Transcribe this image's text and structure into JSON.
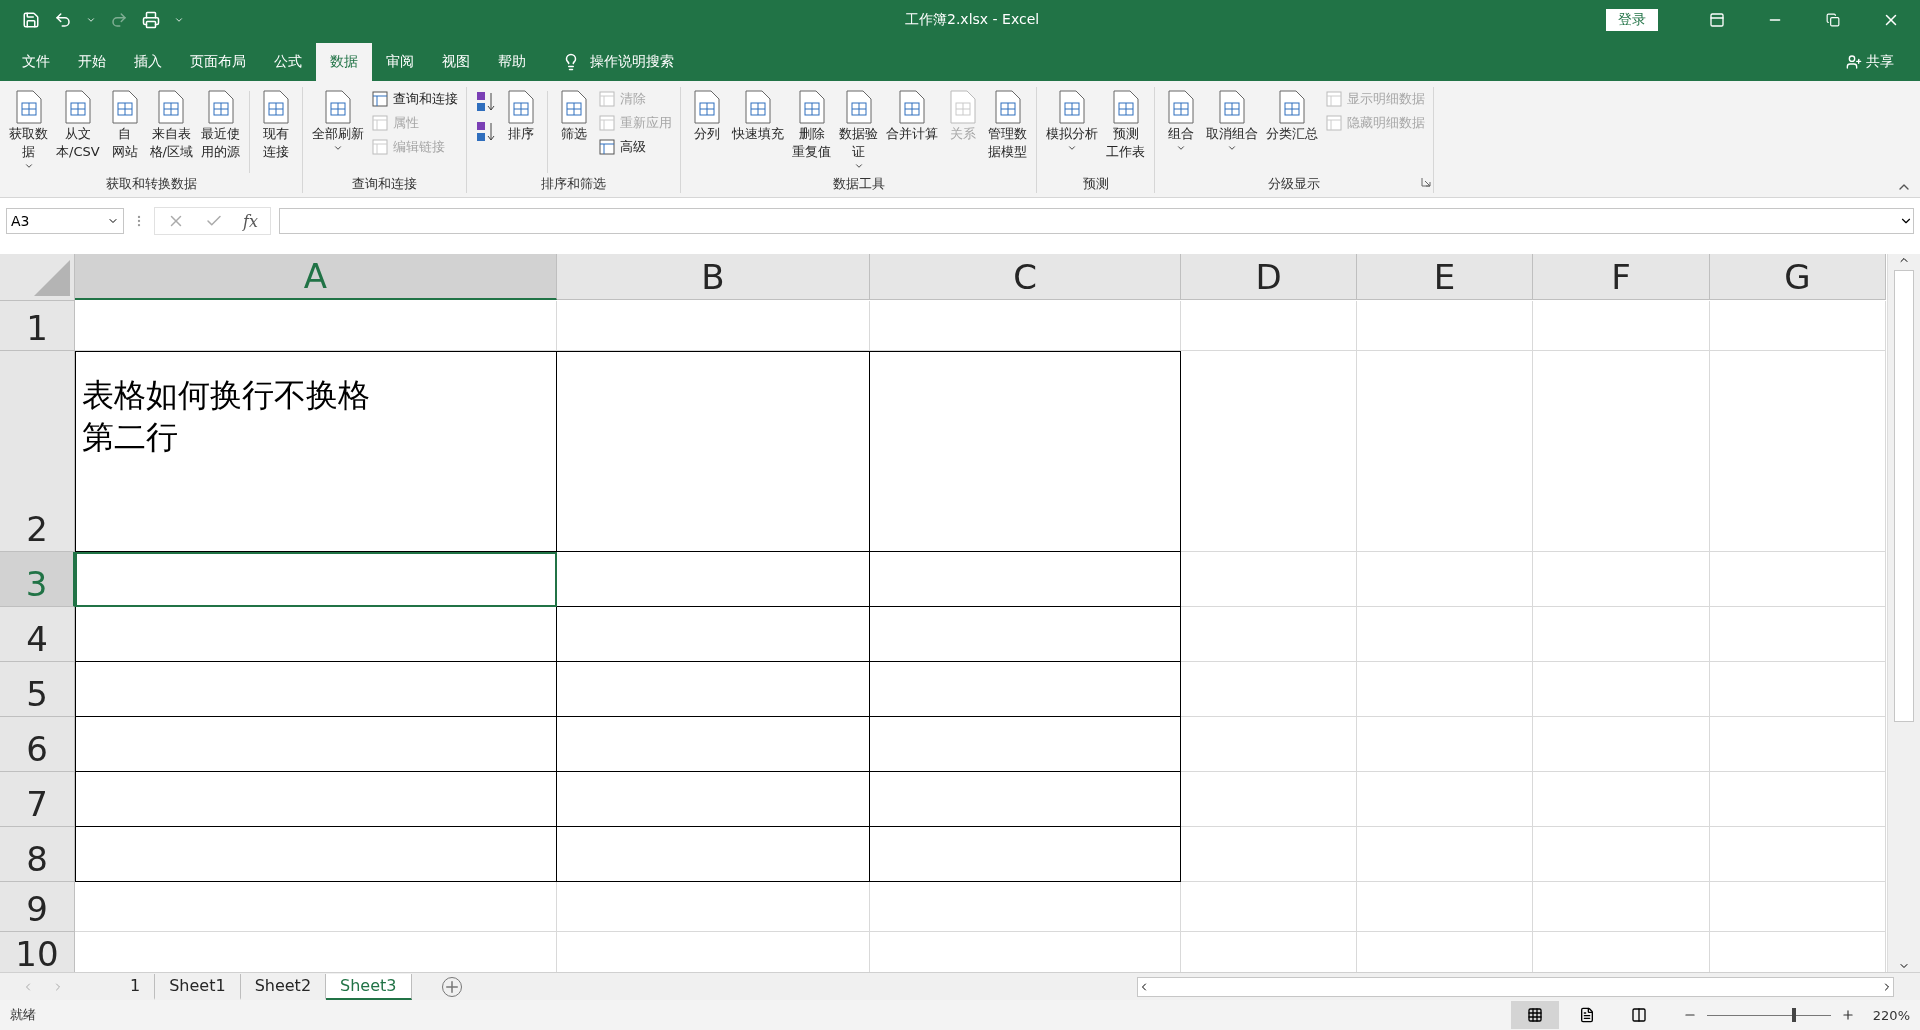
{
  "window": {
    "title": "工作簿2.xlsx  -  Excel",
    "sign_in": "登录"
  },
  "menu_tabs": [
    {
      "label": "文件",
      "selected": false
    },
    {
      "label": "开始",
      "selected": false
    },
    {
      "label": "插入",
      "selected": false
    },
    {
      "label": "页面布局",
      "selected": false
    },
    {
      "label": "公式",
      "selected": false
    },
    {
      "label": "数据",
      "selected": true
    },
    {
      "label": "审阅",
      "selected": false
    },
    {
      "label": "视图",
      "selected": false
    },
    {
      "label": "帮助",
      "selected": false
    }
  ],
  "tell_me": {
    "placeholder": "操作说明搜索"
  },
  "share": "共享",
  "ribbon_groups": [
    {
      "label": "获取和转换数据",
      "items": [
        {
          "kind": "large",
          "lines": [
            "获取数",
            "据"
          ],
          "dropdown": true,
          "disabled": false
        },
        {
          "kind": "large",
          "lines": [
            "从文",
            "本/CSV"
          ],
          "dropdown": false,
          "disabled": false
        },
        {
          "kind": "large",
          "lines": [
            "自",
            "网站"
          ],
          "dropdown": false,
          "disabled": false
        },
        {
          "kind": "large",
          "lines": [
            "来自表",
            "格/区域"
          ],
          "dropdown": false,
          "disabled": false
        },
        {
          "kind": "large",
          "lines": [
            "最近使",
            "用的源"
          ],
          "dropdown": false,
          "disabled": false
        },
        {
          "kind": "separator"
        },
        {
          "kind": "large",
          "lines": [
            "现有",
            "连接"
          ],
          "dropdown": false,
          "disabled": false
        }
      ]
    },
    {
      "label": "查询和连接",
      "items": [
        {
          "kind": "large",
          "lines": [
            "全部刷新"
          ],
          "dropdown": true,
          "disabled": false
        },
        {
          "kind": "stack",
          "items": [
            {
              "kind": "small",
              "label": "查询和连接",
              "disabled": false
            },
            {
              "kind": "small",
              "label": "属性",
              "disabled": true
            },
            {
              "kind": "small",
              "label": "编辑链接",
              "disabled": true
            }
          ]
        }
      ]
    },
    {
      "label": "排序和筛选",
      "items": [
        {
          "kind": "stack",
          "items": [
            {
              "kind": "icon"
            },
            {
              "kind": "icon"
            }
          ]
        },
        {
          "kind": "large",
          "lines": [
            "排序"
          ],
          "dropdown": false,
          "disabled": false
        },
        {
          "kind": "separator"
        },
        {
          "kind": "large",
          "lines": [
            "筛选"
          ],
          "dropdown": false,
          "disabled": false
        },
        {
          "kind": "stack",
          "items": [
            {
              "kind": "small",
              "label": "清除",
              "disabled": true
            },
            {
              "kind": "small",
              "label": "重新应用",
              "disabled": true
            },
            {
              "kind": "small",
              "label": "高级",
              "disabled": false
            }
          ]
        }
      ]
    },
    {
      "label": "数据工具",
      "items": [
        {
          "kind": "large",
          "lines": [
            "分列"
          ],
          "dropdown": false,
          "disabled": false
        },
        {
          "kind": "large",
          "lines": [
            "快速填充"
          ],
          "dropdown": false,
          "disabled": false
        },
        {
          "kind": "large",
          "lines": [
            "删除",
            "重复值"
          ],
          "dropdown": false,
          "disabled": false
        },
        {
          "kind": "large",
          "lines": [
            "数据验",
            "证"
          ],
          "dropdown": true,
          "disabled": false
        },
        {
          "kind": "large",
          "lines": [
            "合并计算"
          ],
          "dropdown": false,
          "disabled": false
        },
        {
          "kind": "large",
          "lines": [
            "关系"
          ],
          "dropdown": false,
          "disabled": true
        },
        {
          "kind": "large",
          "lines": [
            "管理数",
            "据模型"
          ],
          "dropdown": false,
          "disabled": false
        }
      ]
    },
    {
      "label": "预测",
      "items": [
        {
          "kind": "large",
          "lines": [
            "模拟分析"
          ],
          "dropdown": true,
          "disabled": false
        },
        {
          "kind": "large",
          "lines": [
            "预测",
            "工作表"
          ],
          "dropdown": false,
          "disabled": false
        }
      ]
    },
    {
      "label": "分级显示",
      "launcher": true,
      "items": [
        {
          "kind": "large",
          "lines": [
            "组合"
          ],
          "dropdown": true,
          "disabled": false
        },
        {
          "kind": "large",
          "lines": [
            "取消组合"
          ],
          "dropdown": true,
          "disabled": false
        },
        {
          "kind": "large",
          "lines": [
            "分类汇总"
          ],
          "dropdown": false,
          "disabled": false
        },
        {
          "kind": "stack",
          "items": [
            {
              "kind": "small",
              "label": "显示明细数据",
              "disabled": true
            },
            {
              "kind": "small",
              "label": "隐藏明细数据",
              "disabled": true
            }
          ]
        }
      ]
    }
  ],
  "formula_bar": {
    "name_box": "A3",
    "fx": "fx"
  },
  "columns": [
    {
      "label": "A",
      "selected": true
    },
    {
      "label": "B",
      "selected": false
    },
    {
      "label": "C",
      "selected": false
    },
    {
      "label": "D",
      "selected": false
    },
    {
      "label": "E",
      "selected": false
    },
    {
      "label": "F",
      "selected": false
    },
    {
      "label": "G",
      "selected": false
    }
  ],
  "rows": [
    {
      "number": "1",
      "selected": false,
      "bordered": false
    },
    {
      "number": "2",
      "selected": false,
      "bordered": true,
      "cells": [
        {
          "lines": [
            "表格如何换行不换格",
            "第二行"
          ]
        }
      ]
    },
    {
      "number": "3",
      "selected": true,
      "bordered": true
    },
    {
      "number": "4",
      "selected": false,
      "bordered": true
    },
    {
      "number": "5",
      "selected": false,
      "bordered": true
    },
    {
      "number": "6",
      "selected": false,
      "bordered": true
    },
    {
      "number": "7",
      "selected": false,
      "bordered": true
    },
    {
      "number": "8",
      "selected": false,
      "bordered": true
    },
    {
      "number": "9",
      "selected": false,
      "bordered": false
    },
    {
      "number": "10",
      "selected": false,
      "bordered": false
    }
  ],
  "sheet_tabs": [
    {
      "label": "1",
      "selected": false
    },
    {
      "label": "Sheet1",
      "selected": false
    },
    {
      "label": "Sheet2",
      "selected": false
    },
    {
      "label": "Sheet3",
      "selected": true
    }
  ],
  "status_bar": {
    "status": "就绪",
    "zoom": "220%",
    "zoom_slider": {
      "level": 0.69
    }
  }
}
